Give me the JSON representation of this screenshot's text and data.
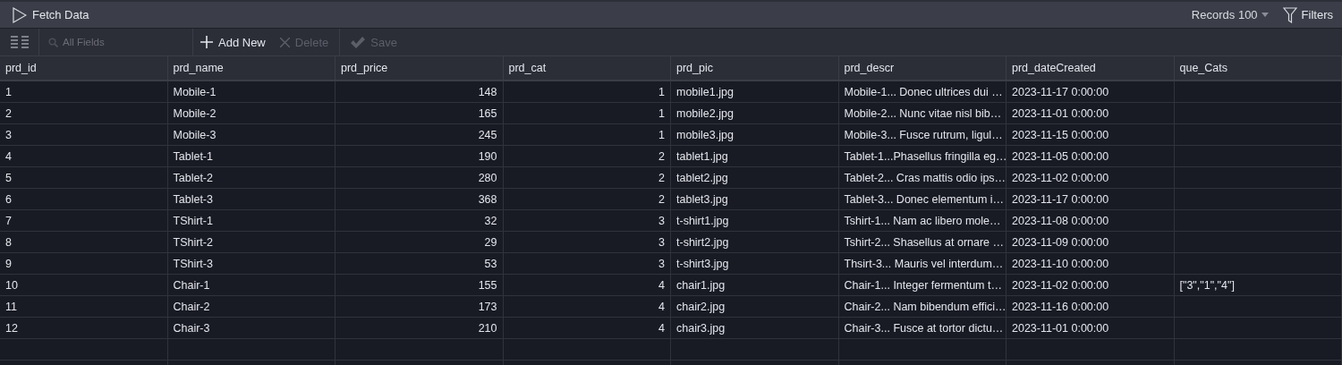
{
  "title_bar": {
    "action": "Fetch Data",
    "records_label": "Records",
    "records_value": "100",
    "filters": "Filters"
  },
  "toolbar": {
    "search_placeholder": "All Fields",
    "buttons": [
      {
        "label": "Add New",
        "kind": "add",
        "disabled": false
      },
      {
        "label": "Delete",
        "kind": "delete",
        "disabled": true
      },
      {
        "label": "Save",
        "kind": "save",
        "disabled": true
      }
    ]
  },
  "table": {
    "columns": [
      {
        "label": "prd_id",
        "kind": "text"
      },
      {
        "label": "prd_name",
        "kind": "text"
      },
      {
        "label": "prd_price",
        "kind": "number"
      },
      {
        "label": "prd_cat",
        "kind": "number"
      },
      {
        "label": "prd_pic",
        "kind": "text"
      },
      {
        "label": "prd_descr",
        "kind": "text"
      },
      {
        "label": "prd_dateCreated",
        "kind": "text"
      },
      {
        "label": "que_Cats",
        "kind": "text"
      }
    ],
    "rows": [
      [
        "1",
        "Mobile-1",
        "148",
        "1",
        "mobile1.jpg",
        "Mobile-1... Donec ultrices dui …",
        "2023-11-17 0:00:00",
        ""
      ],
      [
        "2",
        "Mobile-2",
        "165",
        "1",
        "mobile2.jpg",
        "Mobile-2... Nunc vitae nisl bib…",
        "2023-11-01 0:00:00",
        ""
      ],
      [
        "3",
        "Mobile-3",
        "245",
        "1",
        "mobile3.jpg",
        "Mobile-3... Fusce rutrum, ligul…",
        "2023-11-15 0:00:00",
        ""
      ],
      [
        "4",
        "Tablet-1",
        "190",
        "2",
        "tablet1.jpg",
        "Tablet-1...Phasellus fringilla eg…",
        "2023-11-05 0:00:00",
        ""
      ],
      [
        "5",
        "Tablet-2",
        "280",
        "2",
        "tablet2.jpg",
        "Tablet-2... Cras mattis odio ips…",
        "2023-11-02 0:00:00",
        ""
      ],
      [
        "6",
        "Tablet-3",
        "368",
        "2",
        "tablet3.jpg",
        "Tablet-3... Donec elementum i…",
        "2023-11-17 0:00:00",
        ""
      ],
      [
        "7",
        "TShirt-1",
        "32",
        "3",
        "t-shirt1.jpg",
        "Tshirt-1... Nam ac libero mole…",
        "2023-11-08 0:00:00",
        ""
      ],
      [
        "8",
        "TShirt-2",
        "29",
        "3",
        "t-shirt2.jpg",
        "Tshirt-2... Shasellus at ornare …",
        "2023-11-09 0:00:00",
        ""
      ],
      [
        "9",
        "TShirt-3",
        "53",
        "3",
        "t-shirt3.jpg",
        "Thsirt-3... Mauris vel interdum…",
        "2023-11-10 0:00:00",
        ""
      ],
      [
        "10",
        "Chair-1",
        "155",
        "4",
        "chair1.jpg",
        "Chair-1... Integer fermentum t…",
        "2023-11-02 0:00:00",
        "[\"3\",\"1\",\"4\"]"
      ],
      [
        "11",
        "Chair-2",
        "173",
        "4",
        "chair2.jpg",
        "Chair-2... Nam bibendum effici…",
        "2023-11-16 0:00:00",
        ""
      ],
      [
        "12",
        "Chair-3",
        "210",
        "4",
        "chair3.jpg",
        "Chair-3... Fusce at tortor dictu…",
        "2023-11-01 0:00:00",
        ""
      ]
    ]
  }
}
